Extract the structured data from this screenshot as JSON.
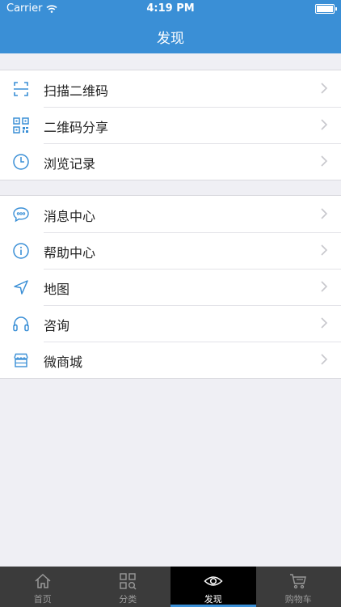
{
  "status_bar": {
    "carrier": "Carrier",
    "time": "4:19 PM"
  },
  "nav": {
    "title": "发现"
  },
  "group1": [
    {
      "label": "扫描二维码",
      "icon": "scan-icon"
    },
    {
      "label": "二维码分享",
      "icon": "qr-code-icon"
    },
    {
      "label": "浏览记录",
      "icon": "clock-icon"
    }
  ],
  "group2": [
    {
      "label": "消息中心",
      "icon": "message-icon"
    },
    {
      "label": "帮助中心",
      "icon": "info-icon"
    },
    {
      "label": "地图",
      "icon": "location-arrow-icon"
    },
    {
      "label": "咨询",
      "icon": "headphones-icon"
    },
    {
      "label": "微商城",
      "icon": "store-icon"
    }
  ],
  "tabbar": [
    {
      "label": "首页",
      "icon": "home-icon"
    },
    {
      "label": "分类",
      "icon": "grid-search-icon"
    },
    {
      "label": "发现",
      "icon": "eye-icon",
      "active": true
    },
    {
      "label": "购物车",
      "icon": "cart-icon"
    }
  ],
  "colors": {
    "accent": "#3a8fd6",
    "tabbar_bg": "#3b3b3b",
    "background": "#efeff4"
  }
}
